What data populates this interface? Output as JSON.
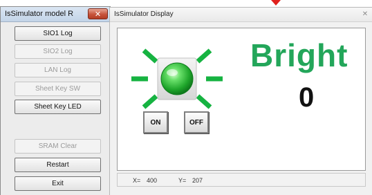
{
  "colors": {
    "accent_arrow": "#e0201c",
    "bright_text": "#23a65a",
    "led_green": "#35c43c",
    "ray_green": "#16b341"
  },
  "left_window": {
    "title": "IsSimulator model R",
    "close_glyph": "✕",
    "buttons": [
      {
        "label": "SIO1 Log",
        "enabled": true
      },
      {
        "label": "SIO2 Log",
        "enabled": false
      },
      {
        "label": "LAN Log",
        "enabled": false
      },
      {
        "label": "Sheet Key SW",
        "enabled": false
      },
      {
        "label": "Sheet Key LED",
        "enabled": true
      },
      {
        "label": "SRAM Clear",
        "enabled": false
      },
      {
        "label": "Restart",
        "enabled": true
      },
      {
        "label": "Exit",
        "enabled": true
      }
    ]
  },
  "right_window": {
    "title": "IsSimulator Display",
    "close_glyph": "✕",
    "led_icon": "green-led-icon",
    "on_label": "ON",
    "off_label": "OFF",
    "bright_label": "Bright",
    "bright_value": "0",
    "status": {
      "x_label": "X=",
      "x_value": "400",
      "y_label": "Y=",
      "y_value": "207"
    }
  }
}
